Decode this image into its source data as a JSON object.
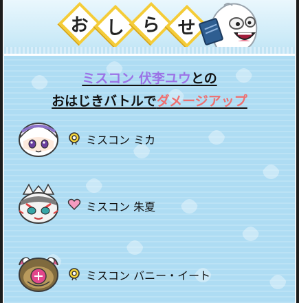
{
  "header": {
    "title_chars": [
      "お",
      "し",
      "ら",
      "せ"
    ]
  },
  "headline": {
    "line1_name": "ミスコン 伏李ユウ",
    "line1_suffix": "との",
    "line2_prefix": "おはじきバトルで",
    "line2_emphasis": "ダメージアップ"
  },
  "items": [
    {
      "label": "ミスコン ミカ",
      "bullet_icon": "yellow-ring-icon"
    },
    {
      "label": "ミスコン 朱夏",
      "bullet_icon": "pink-heart-icon"
    },
    {
      "label": "ミスコン バニー・イート",
      "bullet_icon": "yellow-ring-icon"
    }
  ],
  "colors": {
    "accent_purple": "#9b72e6",
    "accent_red": "#ef6f6f",
    "panel_blue": "#aedcf3",
    "tile_yellow": "#f4cc38"
  }
}
